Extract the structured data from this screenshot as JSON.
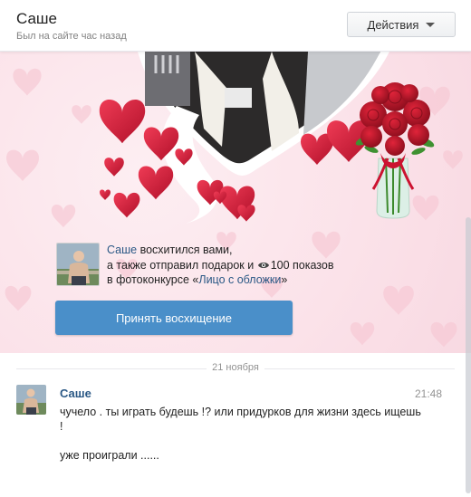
{
  "header": {
    "name": "Саше",
    "status": "Был на сайте час назад",
    "actions_label": "Действия"
  },
  "card": {
    "line1_name": "Саше",
    "line1_rest": " восхитился вами,",
    "line2_prefix": "а также отправил подарок и ",
    "line2_views": "100 показов",
    "line3_prefix": "в фотоконкурсе «",
    "line3_link": "Лицо с обложки",
    "line3_suffix": "»",
    "accept_label": "Принять восхищение"
  },
  "chat": {
    "date": "21 ноября",
    "author": "Саше",
    "time": "21:48",
    "text1": "чучело . ты играть будешь !? или придурков для жизни здесь ищешь !",
    "text2": "уже проиграли ......"
  },
  "colors": {
    "link": "#2a5885",
    "accept_button": "#4a8fc9",
    "heart": "#d7263d"
  }
}
